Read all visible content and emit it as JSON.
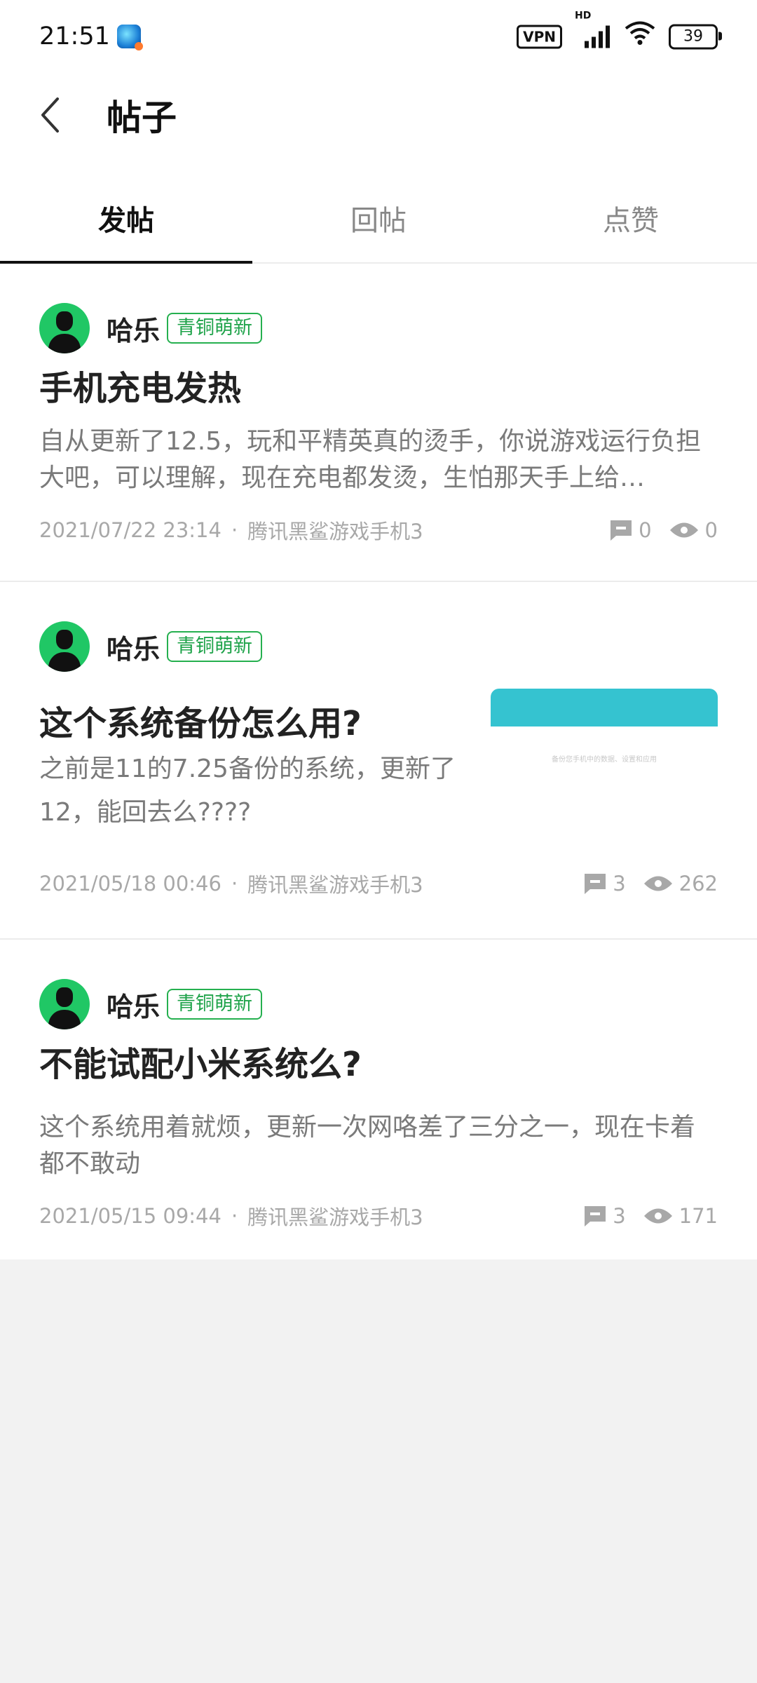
{
  "status_bar": {
    "time": "21:51",
    "vpn": "VPN",
    "network": "HD",
    "battery": "39"
  },
  "header": {
    "title": "帖子"
  },
  "tabs": [
    {
      "label": "发帖",
      "active": true
    },
    {
      "label": "回帖",
      "active": false
    },
    {
      "label": "点赞",
      "active": false
    }
  ],
  "posts": [
    {
      "author": "哈乐",
      "badge": "青铜萌新",
      "title": "手机充电发热",
      "body": "自从更新了12.5，玩和平精英真的烫手，你说游戏运行负担大吧，可以理解，现在充电都发烫，生怕那天手上给…",
      "date": "2021/07/22 23:14",
      "device": "腾讯黑鲨游戏手机3",
      "comments": "0",
      "views": "0"
    },
    {
      "author": "哈乐",
      "badge": "青铜萌新",
      "title": "这个系统备份怎么用?",
      "body": "之前是11的7.25备份的系统，更新了12，能回去么????",
      "date": "2021/05/18 00:46",
      "device": "腾讯黑鲨游戏手机3",
      "comments": "3",
      "views": "262",
      "thumbnail_caption": "备份您手机中的数据、设置和应用"
    },
    {
      "author": "哈乐",
      "badge": "青铜萌新",
      "title": "不能试配小米系统么?",
      "body": "这个系统用着就烦，更新一次网咯差了三分之一，现在卡着都不敢动",
      "date": "2021/05/15 09:44",
      "device": "腾讯黑鲨游戏手机3",
      "comments": "3",
      "views": "171"
    }
  ],
  "colors": {
    "badge_green": "#1fa34a",
    "avatar_green": "#20c765",
    "thumbnail_teal": "#35c3d0",
    "background": "#f2f2f2"
  }
}
